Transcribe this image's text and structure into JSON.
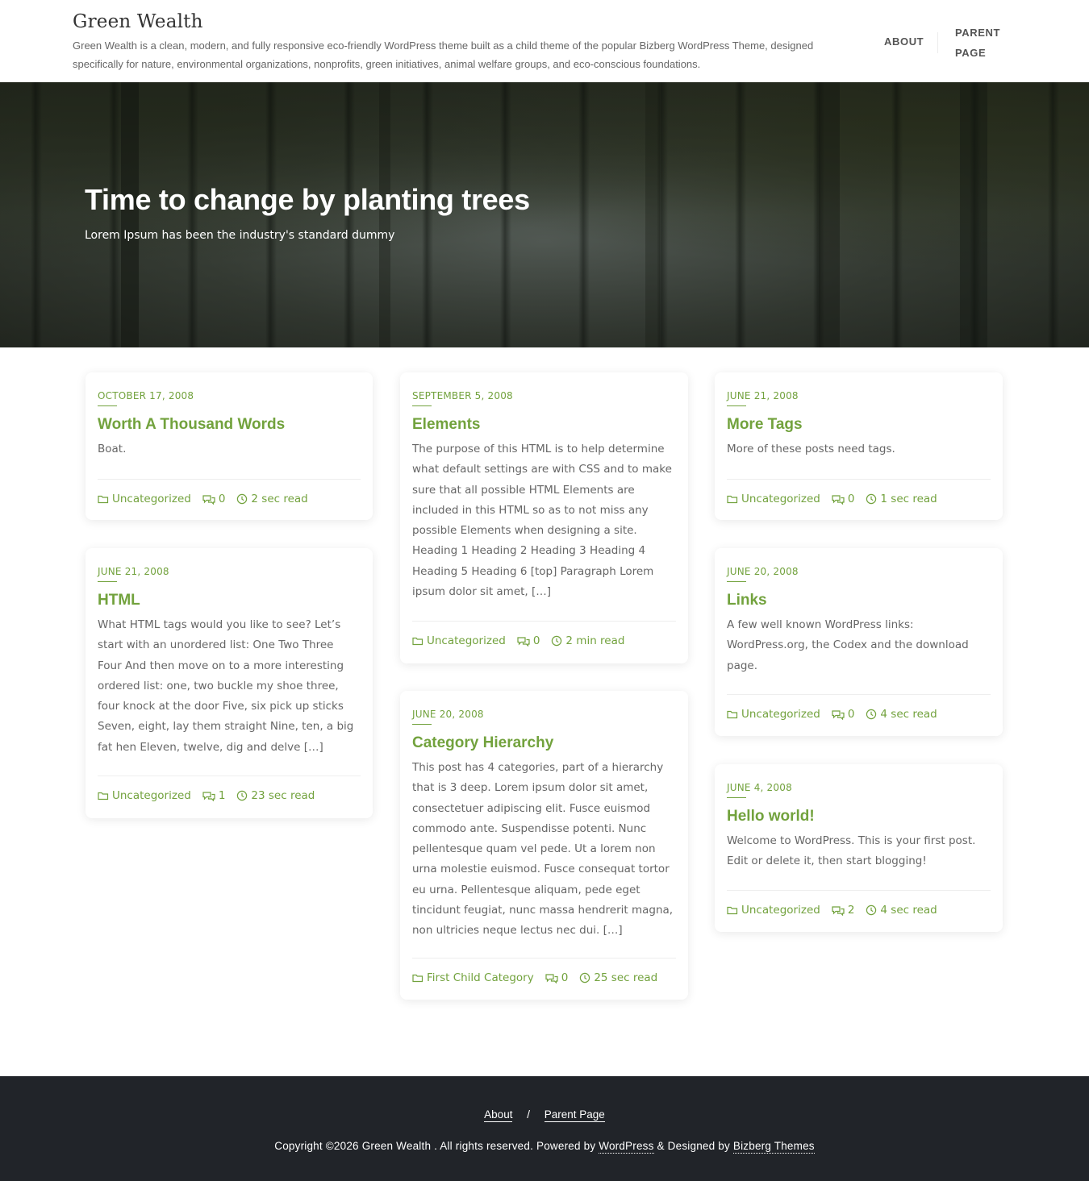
{
  "header": {
    "site_title": "Green Wealth",
    "site_description": "Green Wealth is a clean, modern, and fully responsive eco-friendly WordPress theme built as a child theme of the popular Bizberg WordPress Theme, designed specifically for nature, environmental organizations, nonprofits, green initiatives, animal welfare groups, and eco-conscious foundations.",
    "nav": {
      "about": "ABOUT",
      "parent_page": "PARENT PAGE"
    }
  },
  "hero": {
    "title": "Time to change by planting trees",
    "subtitle": "Lorem Ipsum has been the industry's standard dummy"
  },
  "posts": [
    {
      "date": "October 17, 2008",
      "title": "Worth A Thousand Words",
      "excerpt": "Boat.",
      "category": "Uncategorized",
      "comments": "0",
      "read_time": "2 sec read"
    },
    {
      "date": "September 5, 2008",
      "title": "Elements",
      "excerpt": "The purpose of this HTML is to help determine what default settings are with CSS and to make sure that all possible HTML Elements are included in this HTML so as to not miss any possible Elements when designing a site. Heading 1 Heading 2 Heading 3 Heading 4 Heading 5 Heading 6 [top] Paragraph Lorem ipsum dolor sit amet, […]",
      "category": "Uncategorized",
      "comments": "0",
      "read_time": "2 min read"
    },
    {
      "date": "June 21, 2008",
      "title": "More Tags",
      "excerpt": "More of these posts need tags.",
      "category": "Uncategorized",
      "comments": "0",
      "read_time": "1 sec read"
    },
    {
      "date": "June 21, 2008",
      "title": "HTML",
      "excerpt": "What HTML tags would you like to see? Let’s start with an unordered list: One Two Three Four And then move on to a more interesting ordered list: one, two buckle my shoe three, four knock at the door Five, six pick up sticks Seven, eight, lay them straight Nine, ten, a big fat hen Eleven, twelve, dig and delve […]",
      "category": "Uncategorized",
      "comments": "1",
      "read_time": "23 sec read"
    },
    {
      "date": "June 20, 2008",
      "title": "Links",
      "excerpt": "A few well known WordPress links: WordPress.org, the Codex and the download page.",
      "category": "Uncategorized",
      "comments": "0",
      "read_time": "4 sec read"
    },
    {
      "date": "June 20, 2008",
      "title": "Category Hierarchy",
      "excerpt": "This post has 4 categories, part of a hierarchy that is 3 deep. Lorem ipsum dolor sit amet, consectetuer adipiscing elit. Fusce euismod commodo ante. Suspendisse potenti. Nunc pellentesque quam vel pede. Ut a lorem non urna molestie euismod. Fusce consequat tortor eu urna. Pellentesque aliquam, pede eget tincidunt feugiat, nunc massa hendrerit magna, non ultricies neque lectus nec dui. […]",
      "category": "First Child Category",
      "comments": "0",
      "read_time": "25 sec read"
    },
    {
      "date": "June 4, 2008",
      "title": "Hello world!",
      "excerpt": "Welcome to WordPress. This is your first post. Edit or delete it, then start blogging!",
      "category": "Uncategorized",
      "comments": "2",
      "read_time": "4 sec read"
    }
  ],
  "footer": {
    "links": [
      "About",
      "Parent Page"
    ],
    "separator": "/",
    "copyright_prefix": "Copyright ©2026 Green Wealth . All rights reserved. Powered by",
    "wordpress_link": "WordPress",
    "designed_by": "& Designed by",
    "bizberg_link": "Bizberg Themes"
  },
  "colors": {
    "accent": "#72a23d",
    "footer_bg": "#212429"
  }
}
